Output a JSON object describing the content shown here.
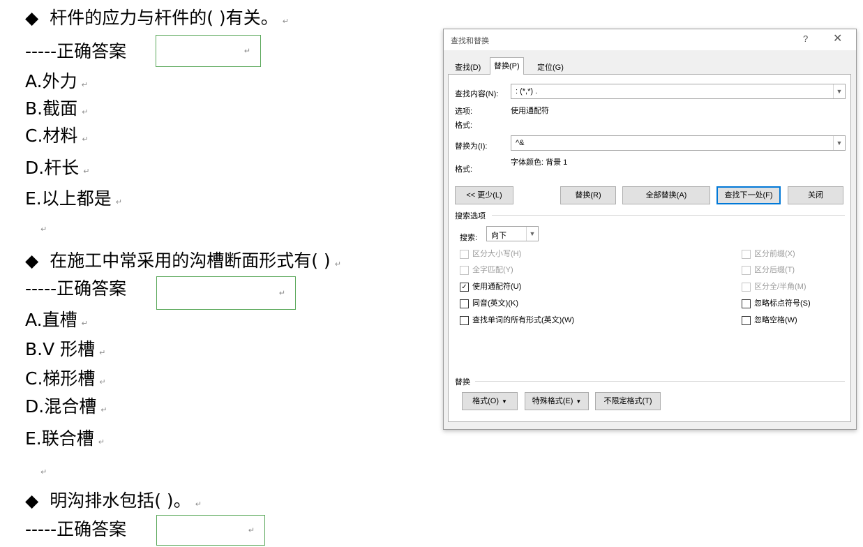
{
  "document": {
    "q1": {
      "bullet": "◆",
      "question": "杆件的应力与杆件的(    )有关。",
      "answer_label": "-----正确答案",
      "options": [
        "A.外力",
        "B.截面",
        "C.材料",
        "D.杆长",
        "E.以上都是"
      ]
    },
    "q2": {
      "bullet": "◆",
      "question": "在施工中常采用的沟槽断面形式有(       )",
      "answer_label": "-----正确答案",
      "options": [
        "A.直槽",
        "B.V 形槽",
        "C.梯形槽",
        "D.混合槽",
        "E.联合槽"
      ]
    },
    "q3": {
      "bullet": "◆",
      "question": "明沟排水包括(       )。",
      "answer_label": "-----正确答案"
    },
    "paragraph_mark": "↵"
  },
  "dialog": {
    "title": "查找和替换",
    "help": "?",
    "close": "✕",
    "tabs": [
      "查找(D)",
      "替换(P)",
      "定位(G)"
    ],
    "find_label": "查找内容(N):",
    "find_value": ":  (*,*) .",
    "options_label": "选项:",
    "options_value": "使用通配符",
    "format_label": "格式:",
    "replace_label": "替换为(I):",
    "replace_value": "^&",
    "replace_format_label": "格式:",
    "replace_format_value": "字体颜色: 背景 1",
    "buttons": {
      "less": "<< 更少(L)",
      "replace": "替换(R)",
      "replace_all": "全部替换(A)",
      "find_next": "查找下一处(F)",
      "close": "关闭"
    },
    "search_options_title": "搜索选项",
    "search_label": "搜索:",
    "search_value": "向下",
    "checkboxes_left": [
      {
        "label": "区分大小写(H)",
        "checked": false,
        "disabled": true
      },
      {
        "label": "全字匹配(Y)",
        "checked": false,
        "disabled": true
      },
      {
        "label": "使用通配符(U)",
        "checked": true,
        "disabled": false
      },
      {
        "label": "同音(英文)(K)",
        "checked": false,
        "disabled": false
      },
      {
        "label": "查找单词的所有形式(英文)(W)",
        "checked": false,
        "disabled": false
      }
    ],
    "checkboxes_right": [
      {
        "label": "区分前缀(X)",
        "checked": false,
        "disabled": true
      },
      {
        "label": "区分后缀(T)",
        "checked": false,
        "disabled": true
      },
      {
        "label": "区分全/半角(M)",
        "checked": false,
        "disabled": true
      },
      {
        "label": "忽略标点符号(S)",
        "checked": false,
        "disabled": false
      },
      {
        "label": "忽略空格(W)",
        "checked": false,
        "disabled": false
      }
    ],
    "replace_section_title": "替换",
    "bottom_buttons": {
      "format": "格式(O)",
      "special": "特殊格式(E)",
      "no_format": "不限定格式(T)"
    }
  }
}
